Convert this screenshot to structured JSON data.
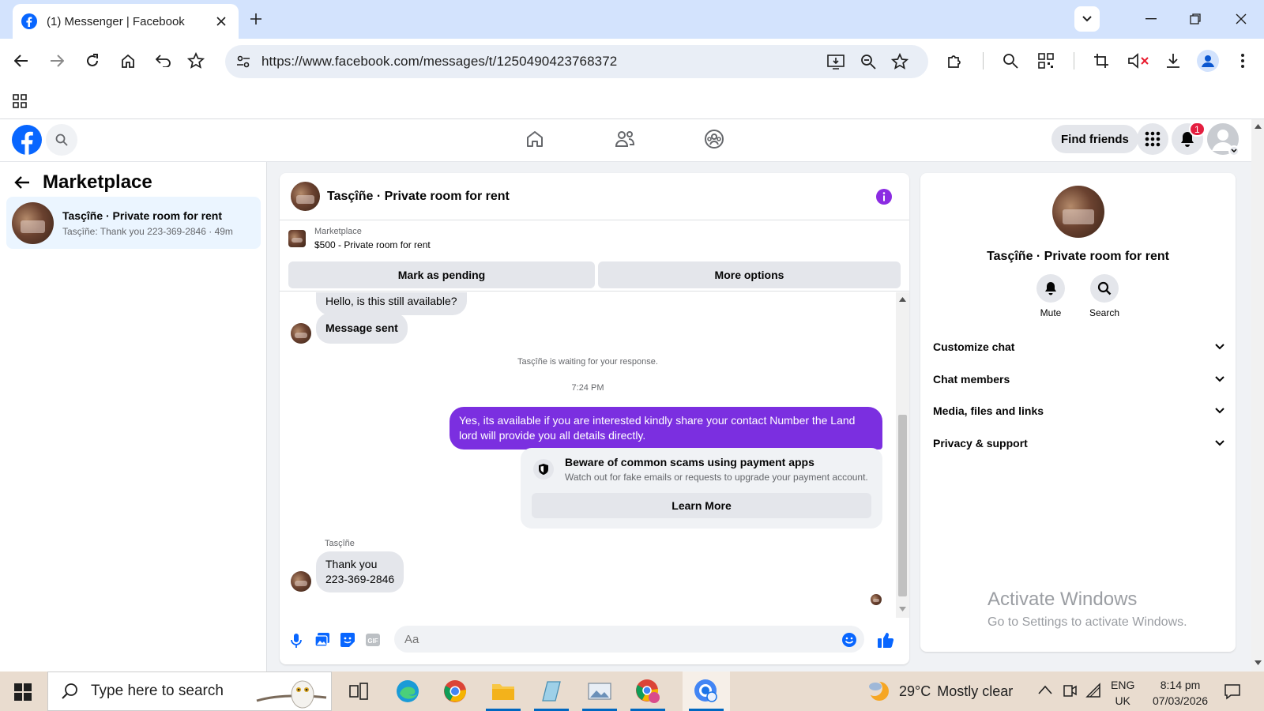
{
  "browser": {
    "tab_title": "(1) Messenger | Facebook",
    "url": "https://www.facebook.com/messages/t/1250490423768372"
  },
  "fb_header": {
    "find_friends_label": "Find friends",
    "notification_count": "1",
    "nav_icons": [
      "home-icon",
      "friends-icon",
      "groups-icon"
    ]
  },
  "sidebar": {
    "title": "Marketplace",
    "conversation": {
      "name": "Tasçîñe · Private room for rent",
      "preview": "Tasçîñe: Thank you 223-369-2846 · 49m"
    }
  },
  "chat": {
    "header_name": "Tasçîñe · Private room for rent",
    "marketplace_label": "Marketplace",
    "listing": "$500 - Private room for rent",
    "mark_pending_label": "Mark as pending",
    "more_options_label": "More options",
    "messages": {
      "m1": "Hello, is this still available?",
      "m2": "Message sent",
      "waiting": "Tasçîñe is waiting for your response.",
      "time": "7:24 PM",
      "out1": "Yes, its available if you are interested kindly share your contact Number the Land lord will provide you all details directly.",
      "sender_name": "Tasçîñe",
      "reply_line1": "Thank you",
      "reply_line2": "223-369-2846"
    },
    "scam_card": {
      "title": "Beware of common scams using payment apps",
      "desc": "Watch out for fake emails or requests to upgrade your payment account.",
      "button": "Learn More"
    },
    "composer_placeholder": "Aa"
  },
  "info_panel": {
    "name": "Tasçîñe · Private room for rent",
    "actions": [
      "Mute",
      "Search"
    ],
    "sections": [
      "Customize chat",
      "Chat members",
      "Media, files and links",
      "Privacy & support"
    ]
  },
  "watermark": {
    "line1": "Activate Windows",
    "line2": "Go to Settings to activate Windows."
  },
  "taskbar": {
    "search_placeholder": "Type here to search",
    "temperature": "29°C",
    "weather": "Mostly clear",
    "lang1": "ENG",
    "lang2": "UK",
    "time": "8:14 pm",
    "date": "07/03/2026"
  },
  "colors": {
    "fb_blue": "#0866ff",
    "outgoing_bubble": "#7b2fe0",
    "notification_red": "#e41e3f"
  }
}
